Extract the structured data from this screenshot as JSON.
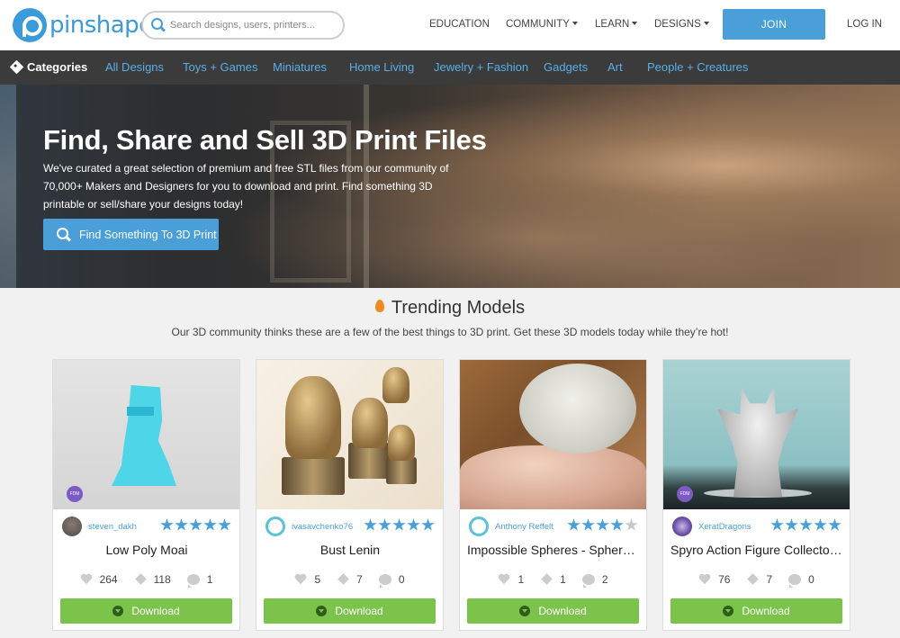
{
  "brand": {
    "name": "pinshape"
  },
  "search": {
    "placeholder": "Search designs, users, printers..."
  },
  "nav": {
    "education": "EDUCATION",
    "community": "COMMUNITY",
    "learn": "LEARN",
    "designs": "DESIGNS",
    "join": "JOIN",
    "login": "LOG IN"
  },
  "categories": {
    "title": "Categories",
    "items": [
      "All Designs",
      "Toys + Games",
      "Miniatures",
      "Home Living",
      "Jewelry + Fashion",
      "Gadgets",
      "Art",
      "People + Creatures"
    ]
  },
  "hero": {
    "title": "Find, Share and Sell 3D Print Files",
    "text": "We've curated a great selection of premium and free STL files from our community of 70,000+ Makers and Designers for you to download and print. Find something 3D printable or sell/share your designs today!",
    "button": "Find Something To 3D Print"
  },
  "trending": {
    "title": "Trending Models",
    "subtitle": "Our 3D community thinks these are a few of the best things to 3D print. Get these 3D models today while they’re hot!"
  },
  "cards": [
    {
      "user": "steven_dakh",
      "name": "Low Poly Moai",
      "likes": "264",
      "makes": "118",
      "comments": "1",
      "rating": 5,
      "fdm": "FDM",
      "download": "Download"
    },
    {
      "user": "ivasavchenko76",
      "name": "Bust Lenin",
      "likes": "5",
      "makes": "7",
      "comments": "0",
      "rating": 5,
      "fdm": "",
      "download": "Download"
    },
    {
      "user": "Anthony Reffelt",
      "name": "Impossible Spheres - Sphere i…",
      "likes": "1",
      "makes": "1",
      "comments": "2",
      "rating": 4,
      "fdm": "",
      "download": "Download"
    },
    {
      "user": "XeratDragons",
      "name": "Spyro Action Figure Collector…",
      "likes": "76",
      "makes": "7",
      "comments": "0",
      "rating": 5,
      "fdm": "FDM",
      "download": "Download"
    }
  ],
  "colors": {
    "accent": "#4a9fd8",
    "download": "#7cc34b",
    "catbar": "#3b3b3b"
  }
}
